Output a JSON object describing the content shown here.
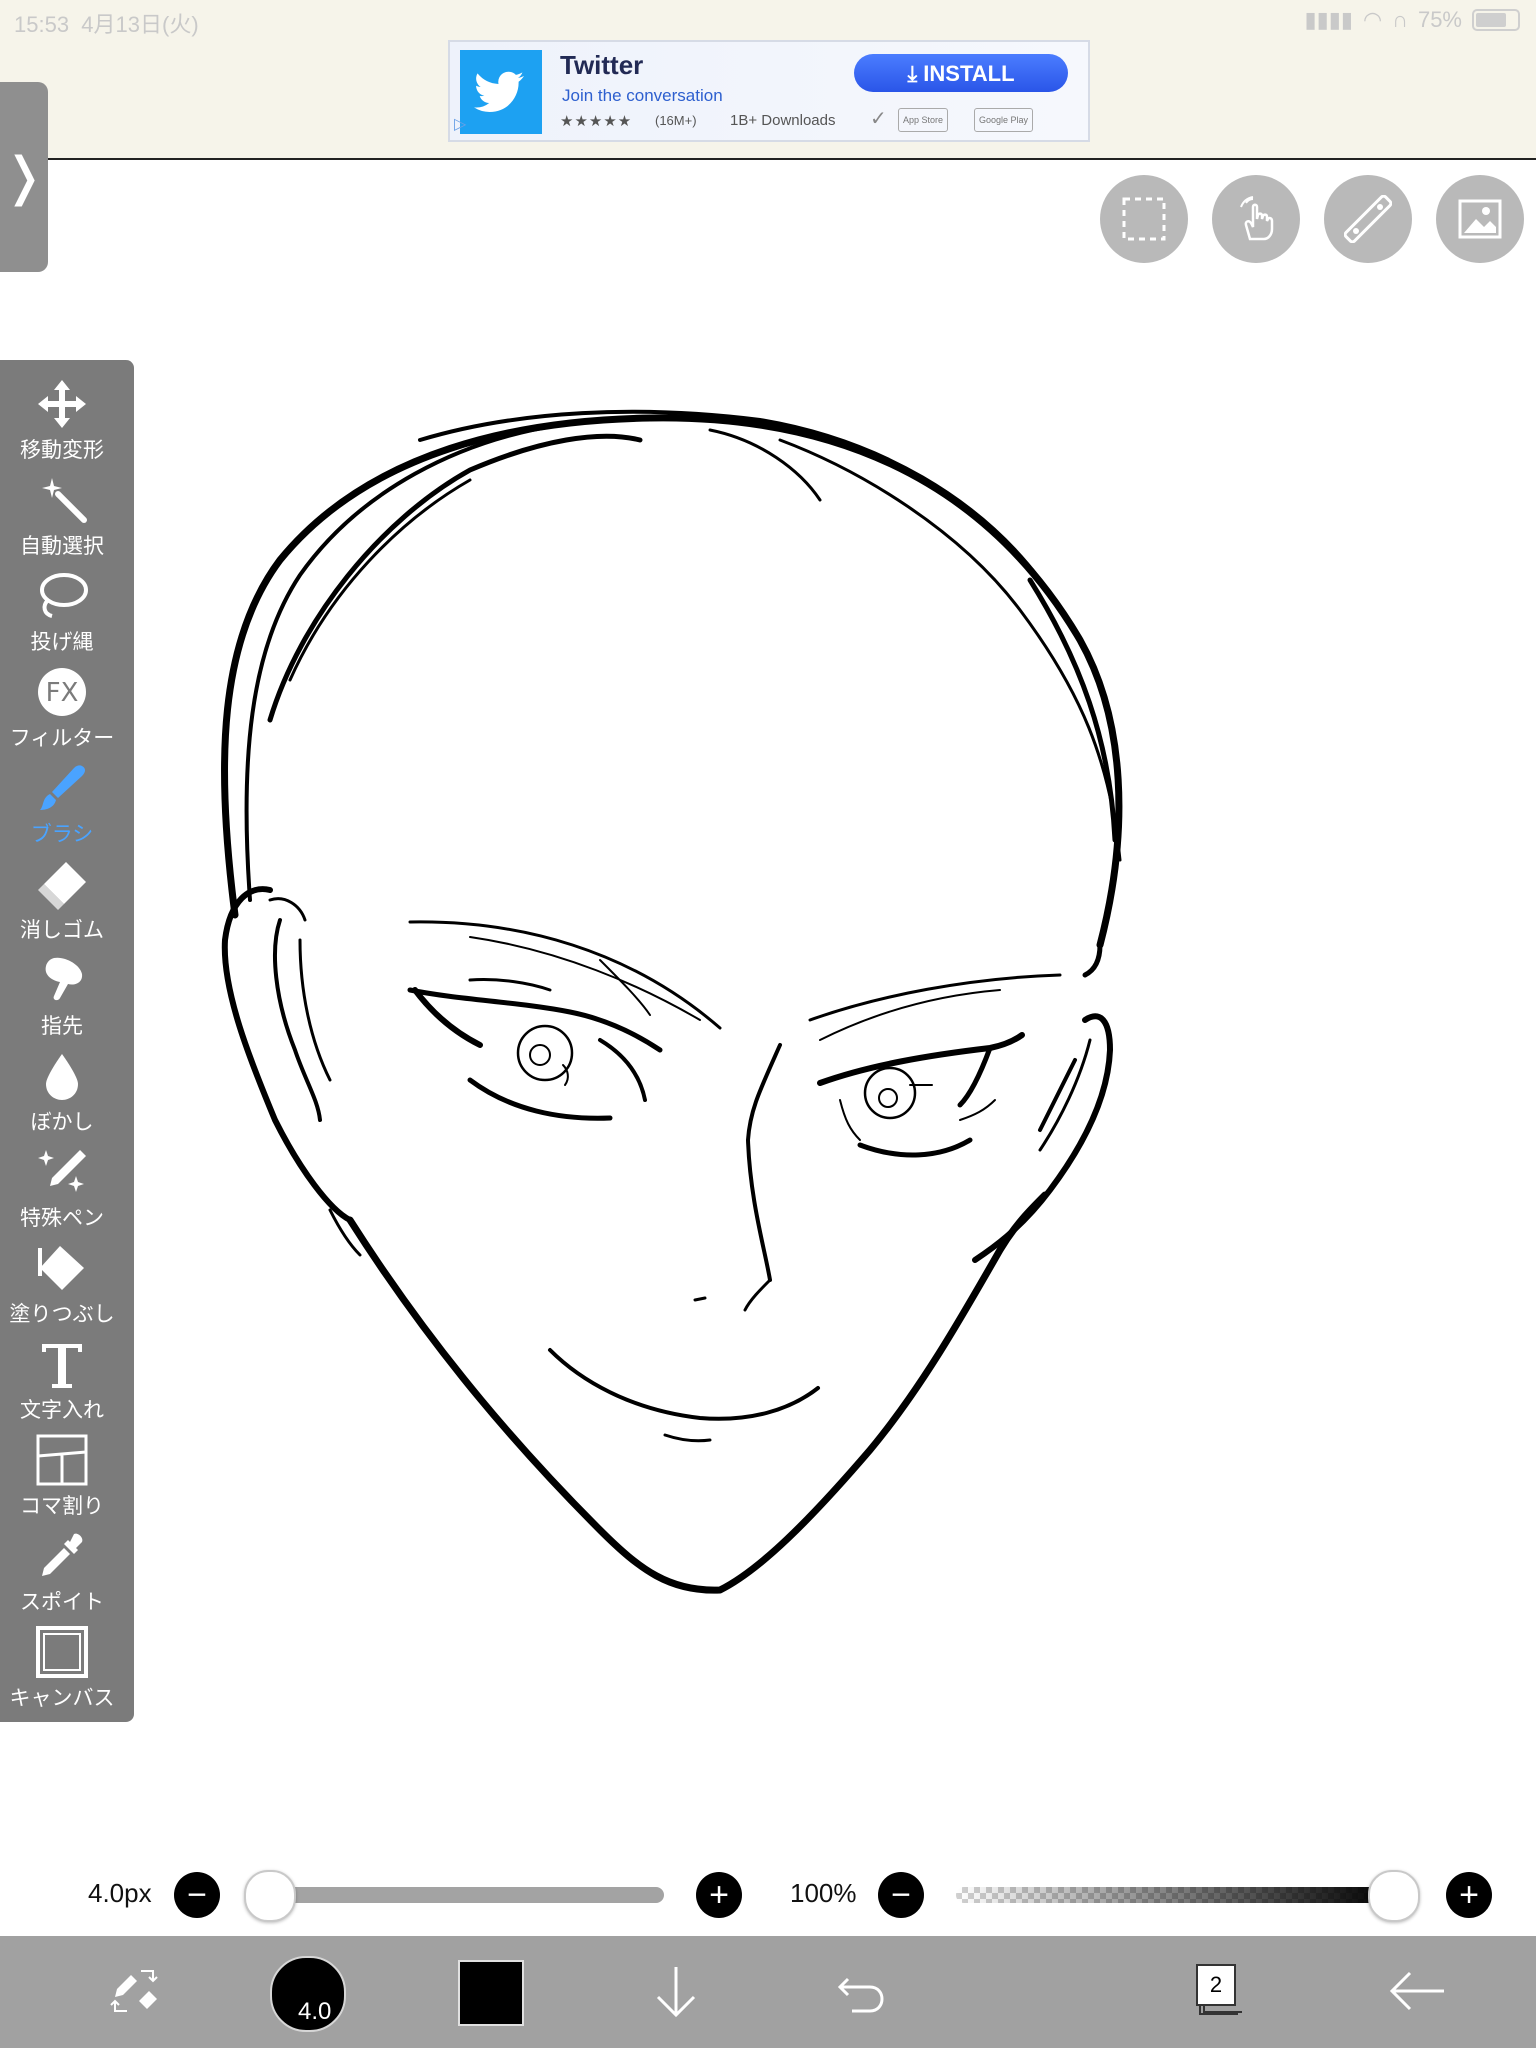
{
  "status_bar": {
    "time": "15:53",
    "date": "4月13日(火)",
    "battery": "75%",
    "battery_level": 0.75
  },
  "ad": {
    "title": "Twitter",
    "subtitle": "Join the conversation",
    "stars": "★★★★★",
    "rating_count": "(16M+)",
    "downloads": "1B+ Downloads",
    "install_label": "INSTALL",
    "app_store": "App Store",
    "google_play": "Google Play"
  },
  "side_toggle": {
    "label": "❭"
  },
  "tools": [
    {
      "id": "move",
      "label": "移動変形"
    },
    {
      "id": "auto-select",
      "label": "自動選択"
    },
    {
      "id": "lasso",
      "label": "投げ縄"
    },
    {
      "id": "filter",
      "label": "フィルター"
    },
    {
      "id": "brush",
      "label": "ブラシ",
      "active": true
    },
    {
      "id": "eraser",
      "label": "消しゴム"
    },
    {
      "id": "finger",
      "label": "指先"
    },
    {
      "id": "blur",
      "label": "ぼかし"
    },
    {
      "id": "special-pen",
      "label": "特殊ペン"
    },
    {
      "id": "fill",
      "label": "塗りつぶし"
    },
    {
      "id": "text",
      "label": "文字入れ"
    },
    {
      "id": "frame-divide",
      "label": "コマ割り"
    },
    {
      "id": "eyedropper",
      "label": "スポイト"
    },
    {
      "id": "canvas",
      "label": "キャンバス"
    }
  ],
  "filter_icon_text": "FX",
  "sliders": {
    "size_label": "4.0px",
    "size_value": 0.0,
    "opacity_label": "100%",
    "opacity_value": 1.0
  },
  "bottom_bar": {
    "brush_size": "4.0",
    "color": "#000000",
    "layer_count": "2"
  },
  "colors": {
    "toolbar_bg": "#7b7b7b",
    "active_accent": "#4aa3ff",
    "bottom_bar_bg": "#a1a1a1",
    "ad_bar_bg": "#f6f4ea"
  }
}
